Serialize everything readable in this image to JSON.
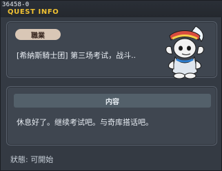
{
  "header": {
    "quest_id": "36458-0",
    "title": "QUEST INFO"
  },
  "job_panel": {
    "job_label": "職業",
    "quest_name": "[希納斯騎士团] 第三场考试，战斗.."
  },
  "content_panel": {
    "header": "内容",
    "text": "休息好了。继续考试吧。与奇库搭话吧。"
  },
  "status": {
    "text": "狀態: 可開始"
  },
  "colors": {
    "title": "#f1c232",
    "pill_bg": "#d9c7b6",
    "panel_bg": "#3f4650"
  },
  "icons": {
    "character": "knight-mascot-icon"
  }
}
